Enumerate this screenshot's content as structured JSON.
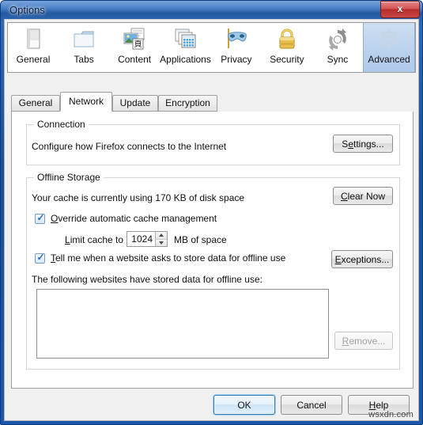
{
  "window": {
    "title": "Options",
    "close_label": "x",
    "close_icon": "close-icon"
  },
  "categories": [
    {
      "label": "General",
      "icon": "general-icon",
      "selected": false
    },
    {
      "label": "Tabs",
      "icon": "tabs-icon",
      "selected": false
    },
    {
      "label": "Content",
      "icon": "content-icon",
      "selected": false
    },
    {
      "label": "Applications",
      "icon": "applications-icon",
      "selected": false
    },
    {
      "label": "Privacy",
      "icon": "privacy-mask-icon",
      "selected": false
    },
    {
      "label": "Security",
      "icon": "security-lock-icon",
      "selected": false
    },
    {
      "label": "Sync",
      "icon": "sync-icon",
      "selected": false
    },
    {
      "label": "Advanced",
      "icon": "advanced-gear-icon",
      "selected": true
    }
  ],
  "tabs": [
    {
      "label": "General",
      "selected": false
    },
    {
      "label": "Network",
      "selected": true
    },
    {
      "label": "Update",
      "selected": false
    },
    {
      "label": "Encryption",
      "selected": false
    }
  ],
  "connection": {
    "group_title": "Connection",
    "description": "Configure how Firefox connects to the Internet",
    "settings_button": {
      "pre": "S",
      "accel": "e",
      "post": "ttings...",
      "full": "Settings..."
    }
  },
  "offline_storage": {
    "group_title": "Offline Storage",
    "cache_usage_text": "Your cache is currently using 170 KB of disk space",
    "cache_size": "170 KB",
    "clear_now_button": {
      "pre": "",
      "accel": "C",
      "post": "lear Now",
      "full": "Clear Now"
    },
    "override_checkbox": {
      "checked": true,
      "pre": "",
      "accel": "O",
      "post": "verride automatic cache management",
      "full": "Override automatic cache management",
      "tick": "✓"
    },
    "limit_label": {
      "pre": "",
      "accel": "L",
      "post": "imit cache to",
      "full": "Limit cache to"
    },
    "limit_value": "1024",
    "limit_units": "MB of space",
    "notify_checkbox": {
      "checked": true,
      "pre": "",
      "accel": "T",
      "post": "ell me when a website asks to store data for offline use",
      "full": "Tell me when a website asks to store data for offline use",
      "tick": "✓"
    },
    "exceptions_button": {
      "pre": "",
      "accel": "E",
      "post": "xceptions...",
      "full": "Exceptions..."
    },
    "list_label": "The following websites have stored data for offline use:",
    "list_items": [],
    "remove_button": {
      "pre": "",
      "accel": "R",
      "post": "emove...",
      "full": "Remove...",
      "disabled": true
    }
  },
  "footer": {
    "ok_button": {
      "full": "OK",
      "default": true
    },
    "cancel_button": {
      "full": "Cancel"
    },
    "help_button": {
      "pre": "",
      "accel": "H",
      "post": "elp",
      "full": "Help"
    }
  },
  "watermark": "wsxdn.com",
  "colors": {
    "frame_blue": "#1c57ab",
    "title_gradient_top": "#7fa8dd",
    "close_red": "#c94747",
    "selected_category": "#bdd3ee",
    "panel_bg": "#ffffff",
    "client_bg": "#f0f0f0",
    "group_border": "#d7d7d7",
    "default_button_glow": "#9fd0ef"
  }
}
